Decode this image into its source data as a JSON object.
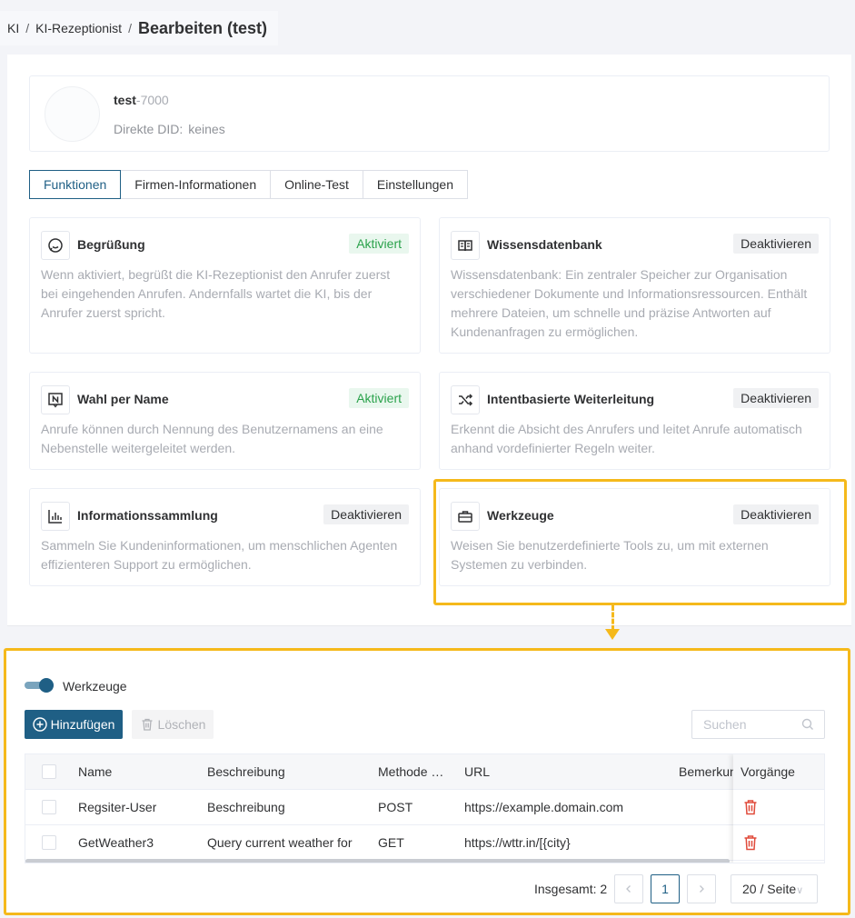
{
  "breadcrumb": {
    "items": [
      "KI",
      "KI-Rezeptionist"
    ],
    "separator": "/",
    "current": "Bearbeiten (test)"
  },
  "profile": {
    "name": "test",
    "extension": "-7000",
    "did_label": "Direkte DID:",
    "did_value": "keines"
  },
  "tabs": [
    {
      "label": "Funktionen",
      "active": true
    },
    {
      "label": "Firmen-Informationen",
      "active": false
    },
    {
      "label": "Online-Test",
      "active": false
    },
    {
      "label": "Einstellungen",
      "active": false
    }
  ],
  "features": [
    {
      "icon": "chat-bubble-icon",
      "title": "Begrüßung",
      "status": "Aktiviert",
      "status_on": true,
      "desc": "Wenn aktiviert, begrüßt die KI-Rezeptionist den Anrufer zuerst bei eingehenden Anrufen. Andernfalls wartet die KI, bis der Anrufer zuerst spricht."
    },
    {
      "icon": "book-icon",
      "title": "Wissensdatenbank",
      "status": "Deaktivieren",
      "status_on": false,
      "desc": "Wissensdatenbank: Ein zentraler Speicher zur Organisation verschiedener Dokumente und Informationsressourcen. Enthält mehrere Dateien, um schnelle und präzise Antworten auf Kundenanfragen zu ermöglichen."
    },
    {
      "icon": "name-n-icon",
      "title": "Wahl per Name",
      "status": "Aktiviert",
      "status_on": true,
      "desc": "Anrufe können durch Nennung des Benutzernamens an eine Nebenstelle weitergeleitet werden."
    },
    {
      "icon": "shuffle-icon",
      "title": "Intentbasierte Weiterleitung",
      "status": "Deaktivieren",
      "status_on": false,
      "desc": "Erkennt die Absicht des Anrufers und leitet Anrufe automatisch anhand vordefinierter Regeln weiter."
    },
    {
      "icon": "bar-chart-icon",
      "title": "Informationssammlung",
      "status": "Deaktivieren",
      "status_on": false,
      "desc": "Sammeln Sie Kundeninformationen, um menschlichen Agenten effizienteren Support zu ermöglichen."
    },
    {
      "icon": "toolbox-icon",
      "title": "Werkzeuge",
      "status": "Deaktivieren",
      "status_on": false,
      "desc": "Weisen Sie benutzerdefinierte Tools zu, um mit externen Systemen zu verbinden."
    }
  ],
  "tools": {
    "switch_label": "Werkzeuge",
    "switch_on": true,
    "add_label": "Hinzufügen",
    "delete_label": "Löschen",
    "search_placeholder": "Suchen",
    "columns": [
      "Name",
      "Beschreibung",
      "Methode …",
      "URL",
      "Bemerkung",
      "Vorgänge"
    ],
    "rows": [
      {
        "name": "Regsiter-User",
        "description": "Beschreibung",
        "method": "POST",
        "url": "https://example.domain.com",
        "remark": ""
      },
      {
        "name": "GetWeather3",
        "description": "Query current weather for",
        "method": "GET",
        "url": "https://wttr.in/[{city}",
        "remark": ""
      }
    ],
    "colors": {
      "accent": "#1f5f85",
      "delete": "#e04a3a",
      "highlight": "#f5b91b",
      "active_badge": "#2ba24c"
    }
  },
  "pagination": {
    "total_label": "Insgesamt: 2",
    "current_page": "1",
    "page_size": "20 / Seite"
  }
}
